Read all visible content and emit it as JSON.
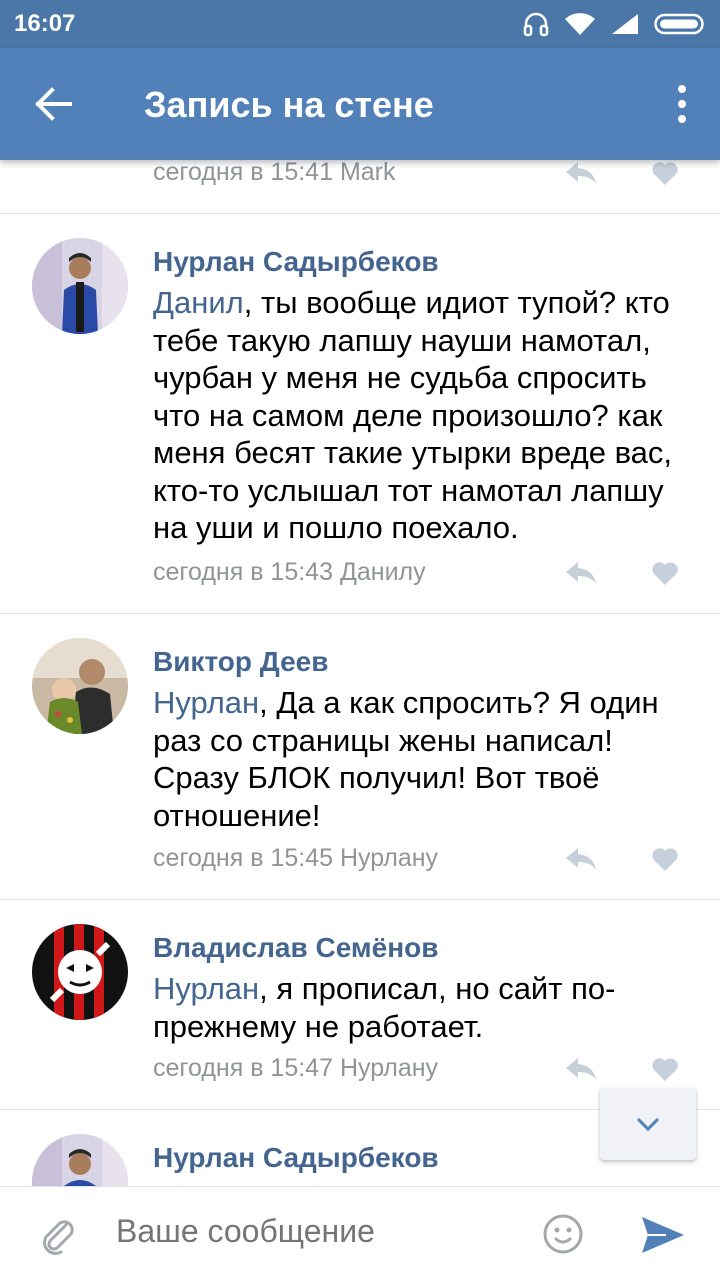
{
  "status_bar": {
    "time": "16:07"
  },
  "header": {
    "title": "Запись на стене"
  },
  "comments": [
    {
      "author": "",
      "mention": "",
      "text": "",
      "meta": "сегодня в 15:41 Mark"
    },
    {
      "author": "Нурлан Садырбеков",
      "mention": "Данил",
      "text": ", ты вообще идиот тупой? кто тебе такую лапшу науши намотал, чурбан у меня не судьба спросить что на самом деле произошло? как меня бесят такие утырки вреде вас, кто-то услышал тот намотал лапшу на уши и пошло поехало.",
      "meta": "сегодня в 15:43 Данилу"
    },
    {
      "author": "Виктор Деев",
      "mention": "Нурлан",
      "text": ", Да а как спросить? Я один раз со страницы жены написал! Сразу БЛОК получил! Вот твоё отношение!",
      "meta": "сегодня в 15:45 Нурлану"
    },
    {
      "author": "Владислав Семёнов",
      "mention": "Нурлан",
      "text": ", я прописал, но сайт по-прежнему не работает.",
      "meta": "сегодня в 15:47 Нурлану"
    },
    {
      "author": "Нурлан Садырбеков",
      "mention": "",
      "text": "",
      "meta": ""
    }
  ],
  "composer": {
    "placeholder": "Ваше сообщение"
  },
  "colors": {
    "header": "#5181b8",
    "status_bar": "#4a76a8",
    "link": "#43658f",
    "meta": "#909499"
  }
}
